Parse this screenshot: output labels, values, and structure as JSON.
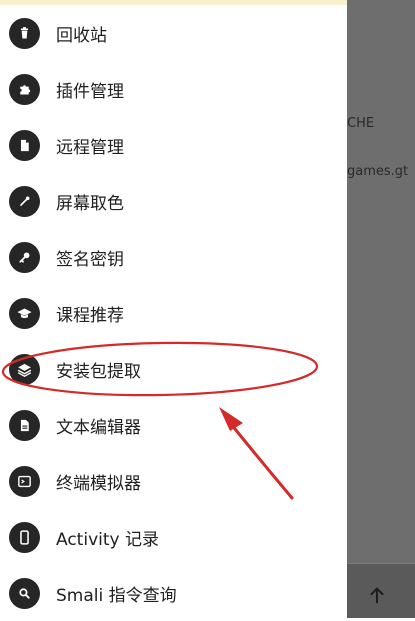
{
  "menu": {
    "items": [
      {
        "label": "回收站",
        "icon": "trash-icon"
      },
      {
        "label": "插件管理",
        "icon": "puzzle-icon"
      },
      {
        "label": "远程管理",
        "icon": "file-icon"
      },
      {
        "label": "屏幕取色",
        "icon": "eyedropper-icon"
      },
      {
        "label": "签名密钥",
        "icon": "key-icon"
      },
      {
        "label": "课程推荐",
        "icon": "graduation-cap-icon"
      },
      {
        "label": "安装包提取",
        "icon": "layers-icon"
      },
      {
        "label": "文本编辑器",
        "icon": "document-icon"
      },
      {
        "label": "终端模拟器",
        "icon": "terminal-icon"
      },
      {
        "label": "Activity 记录",
        "icon": "phone-icon"
      },
      {
        "label": "Smali 指令查询",
        "icon": "search-icon"
      }
    ]
  },
  "background": {
    "text_1": "CHE",
    "text_2": "games.gt"
  },
  "bottom_bar": {
    "icon": "arrow-up-icon"
  },
  "annotation": {
    "color": "#d42a2a",
    "highlighted_item": "安装包提取"
  }
}
